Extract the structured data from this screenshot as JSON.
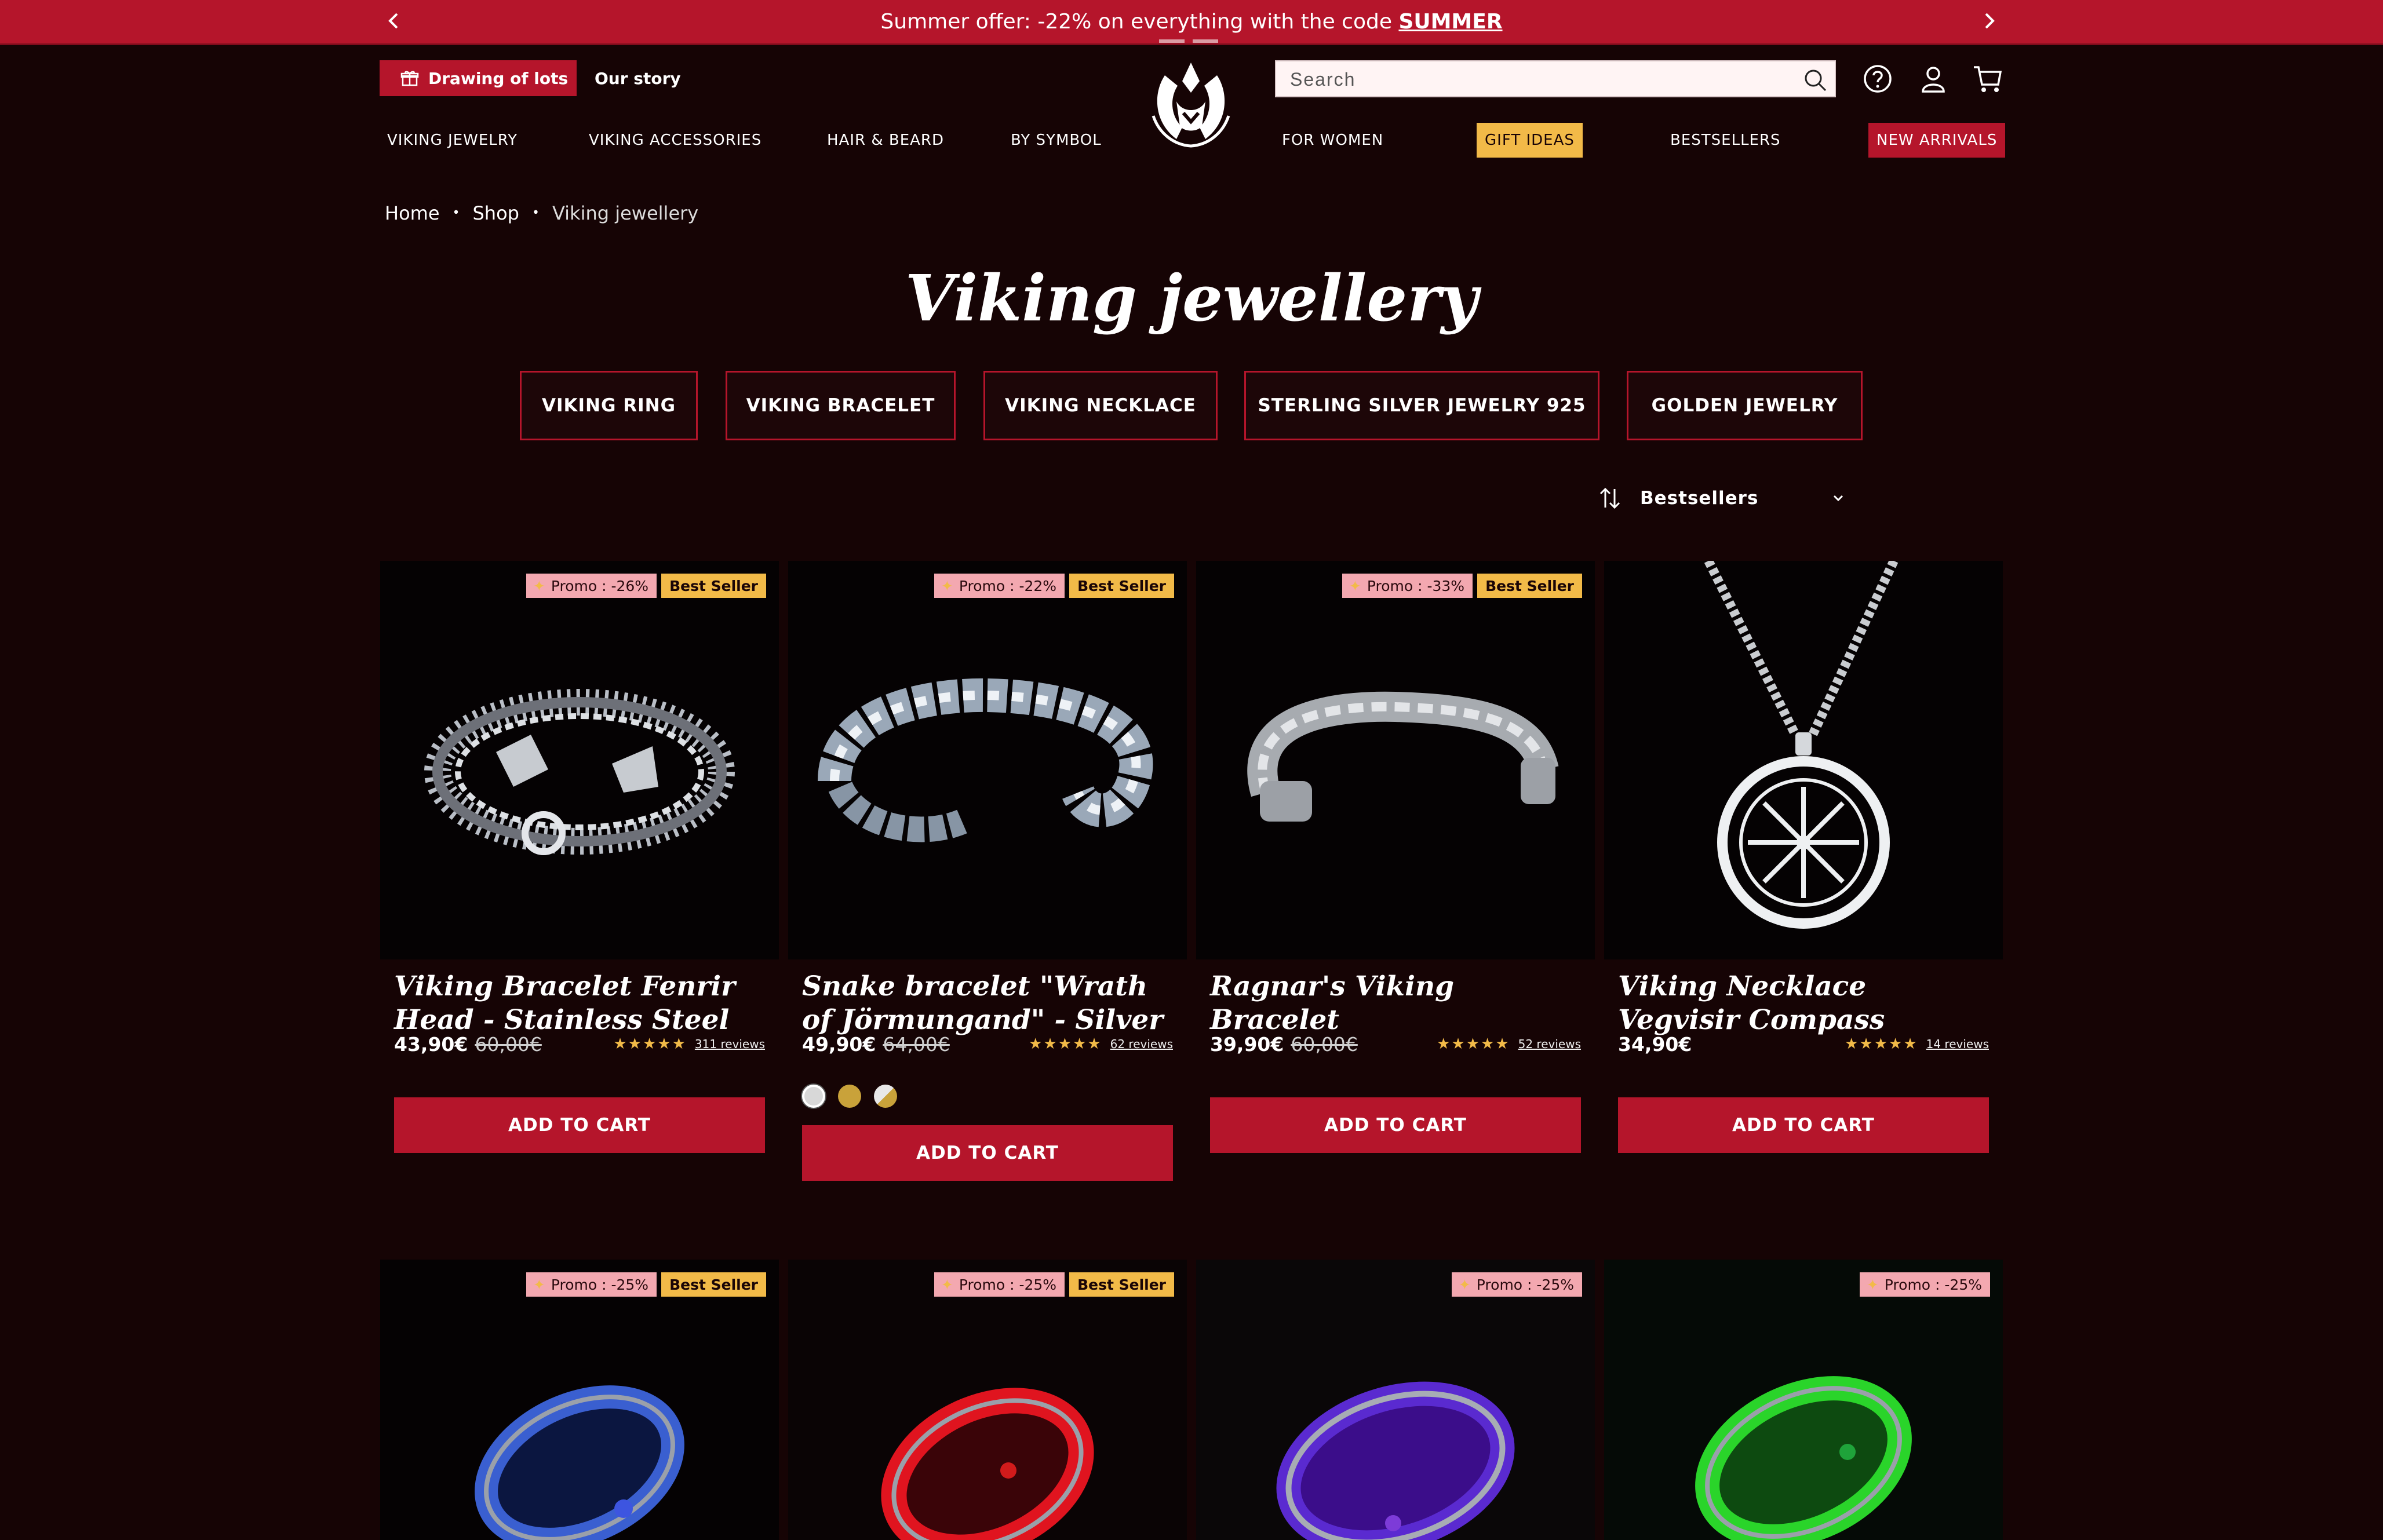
{
  "announcement": {
    "text": "Summer offer: -22% on everything with the code ",
    "code": "SUMMER"
  },
  "header": {
    "promo_label": "Drawing of lots",
    "story_label": "Our story",
    "search_placeholder": "Search"
  },
  "nav": [
    "VIKING JEWELRY",
    "VIKING ACCESSORIES",
    "HAIR & BEARD",
    "BY SYMBOL",
    "FOR WOMEN",
    "GIFT IDEAS",
    "BESTSELLERS",
    "NEW ARRIVALS"
  ],
  "breadcrumb": [
    "Home",
    "Shop",
    "Viking jewellery"
  ],
  "page_title": "Viking jewellery",
  "categories": [
    "VIKING RING",
    "VIKING BRACELET",
    "VIKING NECKLACE",
    "STERLING SILVER JEWELRY 925",
    "GOLDEN JEWELRY"
  ],
  "sort": {
    "label": "Bestsellers"
  },
  "products": [
    {
      "title": "Viking Bracelet Fenrir Head - Stainless Steel",
      "price": "43,90€",
      "old_price": "60,00€",
      "stars": "★★★★★",
      "reviews": "311 reviews",
      "promo": "Promo : -26%",
      "best": "Best Seller",
      "cta": "ADD TO CART"
    },
    {
      "title": "Snake bracelet \"Wrath of Jörmungand\" - Silver",
      "price": "49,90€",
      "old_price": "64,00€",
      "stars": "★★★★★",
      "reviews": "62 reviews",
      "promo": "Promo : -22%",
      "best": "Best Seller",
      "cta": "ADD TO CART"
    },
    {
      "title": "Ragnar's Viking Bracelet",
      "price": "39,90€",
      "old_price": "60,00€",
      "stars": "★★★★★",
      "reviews": "52 reviews",
      "promo": "Promo : -33%",
      "best": "Best Seller",
      "cta": "ADD TO CART"
    },
    {
      "title": "Viking Necklace Vegvisir Compass",
      "price": "34,90€",
      "stars": "★★★★★",
      "reviews": "14 reviews",
      "cta": "ADD TO CART"
    },
    {
      "promo": "Promo : -25%",
      "best": "Best Seller"
    },
    {
      "promo": "Promo : -25%",
      "best": "Best Seller"
    },
    {
      "promo": "Promo : -25%"
    },
    {
      "promo": "Promo : -25%"
    }
  ],
  "colors": {
    "accent": "#b5152b",
    "background": "#160405",
    "gold": "#f2ba48",
    "promo_badge": "#f3a8b0"
  }
}
